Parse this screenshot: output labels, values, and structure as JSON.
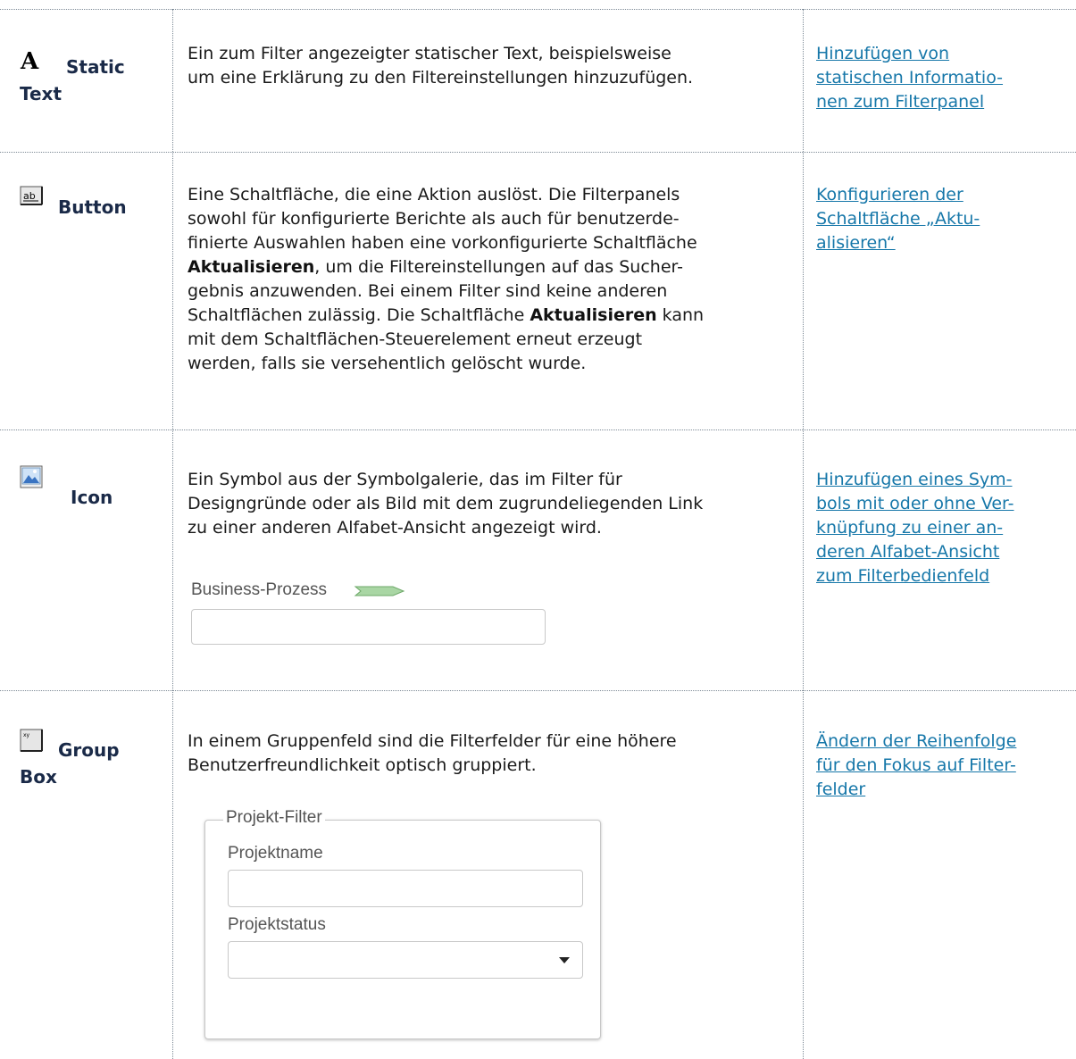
{
  "rows": [
    {
      "name": "Static",
      "name2": "Text",
      "description": "Ein zum Filter angezeigter statischer Text, beispielsweise um eine Erklärung zu den Filtereinstellungen hinzuzufügen.",
      "desc_lines": [
        "Ein zum Filter angezeigter statischer Text, beispielsweise",
        "um eine Erklärung zu den Filtereinstellungen hinzuzufügen."
      ],
      "link_lines": [
        "Hinzufügen von ",
        "statischen Informatio-",
        "nen zum Filterpanel"
      ],
      "icon": "static-text-icon"
    },
    {
      "name": "Button",
      "desc_lines": [
        "Eine Schaltfläche, die eine Aktion auslöst. Die Filterpanels",
        "sowohl für konfigurierte Berichte als auch für benutzerde-",
        "finierte Auswahlen haben eine vorkonfigurierte Schaltfläche",
        "Aktualisieren",
        ", um die Filtereinstellungen auf das Sucher-",
        "gebnis anzuwenden. Bei einem Filter sind keine anderen",
        "Schaltflächen zulässig. Die Schaltfläche ",
        "Aktualisieren",
        " kann",
        "mit dem Schaltflächen-Steuerelement erneut erzeugt",
        "werden, falls sie versehentlich gelöscht wurde."
      ],
      "link_lines": [
        "Konfigurieren der ",
        "Schaltfläche „Aktu-",
        "alisieren“"
      ],
      "icon": "button-control-icon"
    },
    {
      "name": "Icon",
      "desc_lines": [
        "Ein Symbol aus der Symbolgalerie, das im Filter für",
        "Designgründe oder als Bild mit dem zugrundeliegenden Link",
        "zu einer anderen Alfabet-Ansicht angezeigt wird."
      ],
      "example_label": "Business-Prozess",
      "link_lines": [
        "Hinzufügen eines Sym-",
        "bols mit oder ohne Ver-",
        "knüpfung zu einer an-",
        "deren Alfabet-Ansicht ",
        "zum Filterbedienfeld"
      ],
      "icon": "image-icon"
    },
    {
      "name": "Group",
      "name2": "Box",
      "desc_lines": [
        "In einem Gruppenfeld sind die Filterfelder für eine höhere",
        "Benutzerfreundlichkeit optisch gruppiert."
      ],
      "group_legend": "Projekt-Filter",
      "field1_label": "Projektname",
      "field2_label": "Projektstatus",
      "link_lines": [
        "Ändern der Reihenfolge ",
        "für den Fokus auf Filter-",
        "felder"
      ],
      "icon": "group-box-icon"
    }
  ],
  "colors": {
    "link": "#1677a9",
    "name": "#1a2a48",
    "border": "#7d8a96",
    "process_arrow": "#8cc48a"
  }
}
